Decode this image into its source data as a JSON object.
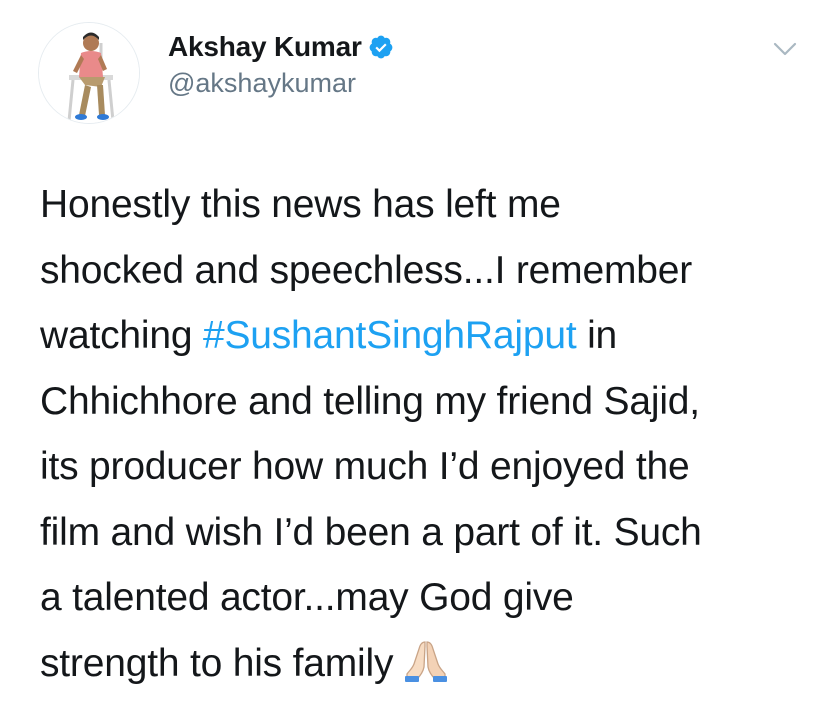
{
  "author": {
    "display_name": "Akshay Kumar",
    "handle": "@akshaykumar",
    "verified": true,
    "avatar_icon": "profile-photo",
    "verified_icon": "verified-badge-icon"
  },
  "menu": {
    "icon": "chevron-down-icon"
  },
  "tweet": {
    "lines": [
      {
        "pre": "Honestly this news has left me"
      },
      {
        "pre": "shocked and speechless...I remember"
      },
      {
        "pre": "watching ",
        "hashtag": "#SushantSinghRajput",
        "post": " in"
      },
      {
        "pre": "Chhichhore and telling my friend Sajid,"
      },
      {
        "pre": "its producer how much I’d enjoyed the"
      },
      {
        "pre": "film and wish I’d been a part of it. Such"
      },
      {
        "pre": "a talented actor...may God give"
      },
      {
        "pre": "strength to his family",
        "emoji": "folded-hands-emoji"
      }
    ]
  },
  "colors": {
    "text": "#14171a",
    "secondary": "#657786",
    "link": "#1da1f2",
    "verified": "#1da1f2"
  }
}
